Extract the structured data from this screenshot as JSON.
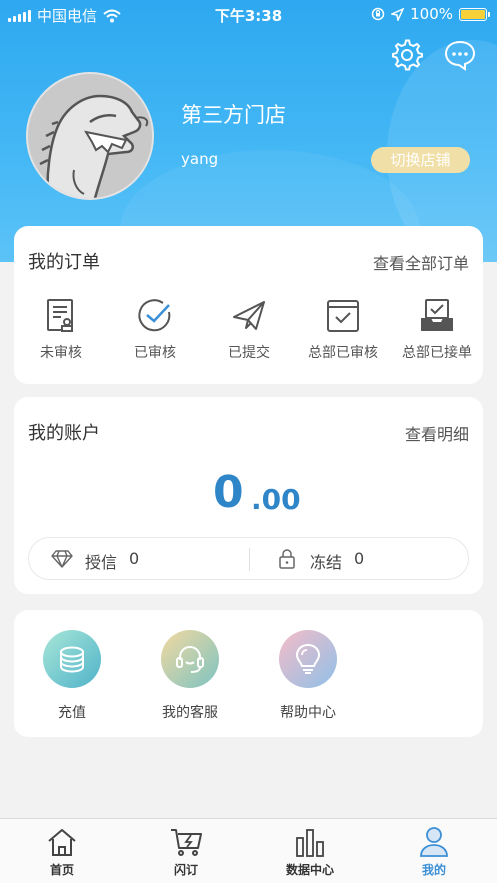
{
  "status_bar": {
    "carrier": "中国电信",
    "time": "下午3:38",
    "battery": "100%",
    "battery_level": 1.0,
    "battery_color": "#f7d13a"
  },
  "header": {
    "settings_icon": "gear-icon",
    "message_icon": "chat-bubble-icon",
    "store_name": "第三方门店",
    "username": "yang",
    "switch_store_label": "切换店铺",
    "accent_color": "#2ea8f0"
  },
  "orders": {
    "title": "我的订单",
    "view_all": "查看全部订单",
    "items": [
      {
        "label": "未审核",
        "icon": "document-stamp-icon"
      },
      {
        "label": "已审核",
        "icon": "check-circle-icon"
      },
      {
        "label": "已提交",
        "icon": "paper-plane-icon"
      },
      {
        "label": "总部已审核",
        "icon": "calendar-check-icon"
      },
      {
        "label": "总部已接单",
        "icon": "inbox-check-icon"
      }
    ]
  },
  "account": {
    "title": "我的账户",
    "view_detail": "查看明细",
    "balance_int": "0",
    "balance_dec": ".00",
    "balance_color": "#2e86c9",
    "credit_label": "授信",
    "credit_value": "0",
    "frozen_label": "冻结",
    "frozen_value": "0"
  },
  "services": [
    {
      "label": "充值",
      "icon": "coins-stack-icon"
    },
    {
      "label": "我的客服",
      "icon": "headset-icon"
    },
    {
      "label": "帮助中心",
      "icon": "lightbulb-icon"
    }
  ],
  "tabbar": {
    "items": [
      {
        "label": "首页",
        "icon": "home-icon"
      },
      {
        "label": "闪订",
        "icon": "flash-cart-icon"
      },
      {
        "label": "数据中心",
        "icon": "bar-chart-icon"
      },
      {
        "label": "我的",
        "icon": "user-icon"
      }
    ],
    "active_index": 3,
    "active_color": "#3b8fd6"
  }
}
